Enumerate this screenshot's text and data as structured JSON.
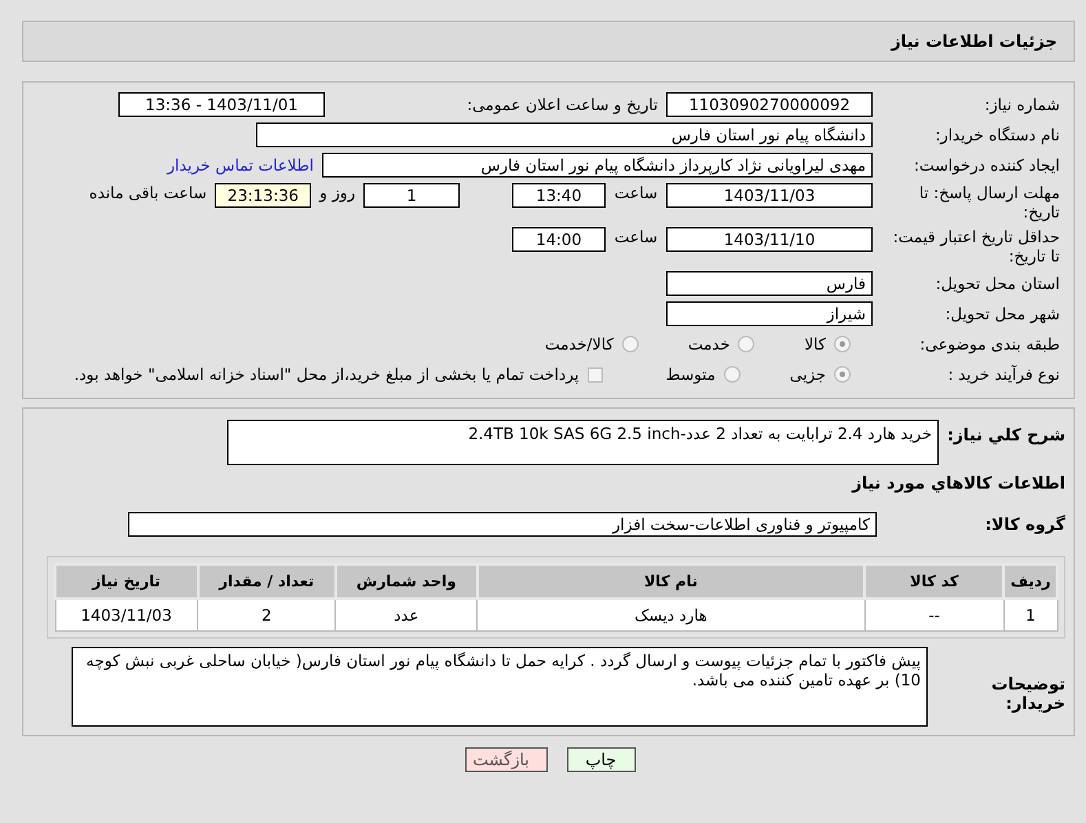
{
  "header": {
    "title": "جزئیات اطلاعات نیاز"
  },
  "details": {
    "need_number": {
      "label": "شماره نیاز:",
      "value": "1103090270000092"
    },
    "announce": {
      "label": "تاریخ و ساعت اعلان عمومی:",
      "value": "1403/11/01 - 13:36"
    },
    "buyer_org": {
      "label": "نام دستگاه خریدار:",
      "value": "دانشگاه پیام نور استان فارس"
    },
    "creator": {
      "label": "ایجاد کننده درخواست:",
      "value": "مهدی لیراویانی نژاد کارپرداز دانشگاه پیام نور استان فارس",
      "link": "اطلاعات تماس خریدار"
    },
    "deadline": {
      "label": "مهلت ارسال پاسخ: تا تاریخ:",
      "date": "1403/11/03",
      "time_label": "ساعت",
      "time": "13:40",
      "days": "1",
      "days_label": "روز و",
      "remaining": "23:13:36",
      "remaining_label": "ساعت باقی مانده"
    },
    "price_validity": {
      "label": "حداقل تاریخ اعتبار قیمت: تا تاریخ:",
      "date": "1403/11/10",
      "time_label": "ساعت",
      "time": "14:00"
    },
    "province": {
      "label": "استان محل تحویل:",
      "value": "فارس"
    },
    "city": {
      "label": "شهر محل تحویل:",
      "value": "شیراز"
    },
    "classification": {
      "label": "طبقه بندی موضوعی:",
      "options": [
        {
          "label": "کالا",
          "selected": true
        },
        {
          "label": "خدمت",
          "selected": false
        },
        {
          "label": "کالا/خدمت",
          "selected": false
        }
      ]
    },
    "process": {
      "label": "نوع فرآیند خرید :",
      "options": [
        {
          "label": "جزیی",
          "selected": true
        },
        {
          "label": "متوسط",
          "selected": false
        }
      ],
      "payment": {
        "label": "پرداخت تمام یا بخشی از مبلغ خرید،از محل \"اسناد خزانه اسلامی\" خواهد بود.",
        "checked": false
      }
    }
  },
  "goods": {
    "summary": {
      "label": "شرح کلي نياز:",
      "value": "خرید  هارد 2.4 ترابایت به تعداد 2 عدد-2.4TB 10k  SAS 6G 2.5 inch"
    },
    "heading": "اطلاعات کالاهاي مورد نياز",
    "group": {
      "label": "گروه کالا:",
      "value": "کامپیوتر و فناوری اطلاعات-سخت افزار"
    },
    "table": {
      "columns": [
        "رديف",
        "کد کالا",
        "نام کالا",
        "واحد شمارش",
        "تعداد / مقدار",
        "تاریخ نیاز"
      ],
      "rows": [
        [
          "1",
          "--",
          "هارد دیسک",
          "عدد",
          "2",
          "1403/11/03"
        ]
      ]
    },
    "notes": {
      "label": "توضیحات خریدار:",
      "value": "پیش فاکتور با تمام جزئیات پیوست و ارسال گردد . کرایه حمل تا دانشگاه پیام نور استان فارس( خیابان ساحلی غربی نبش کوچه 10) بر عهده تامین کننده می باشد."
    }
  },
  "buttons": [
    {
      "kind": "print",
      "label": "چاپ"
    },
    {
      "kind": "back",
      "label": "بازگشت"
    }
  ]
}
